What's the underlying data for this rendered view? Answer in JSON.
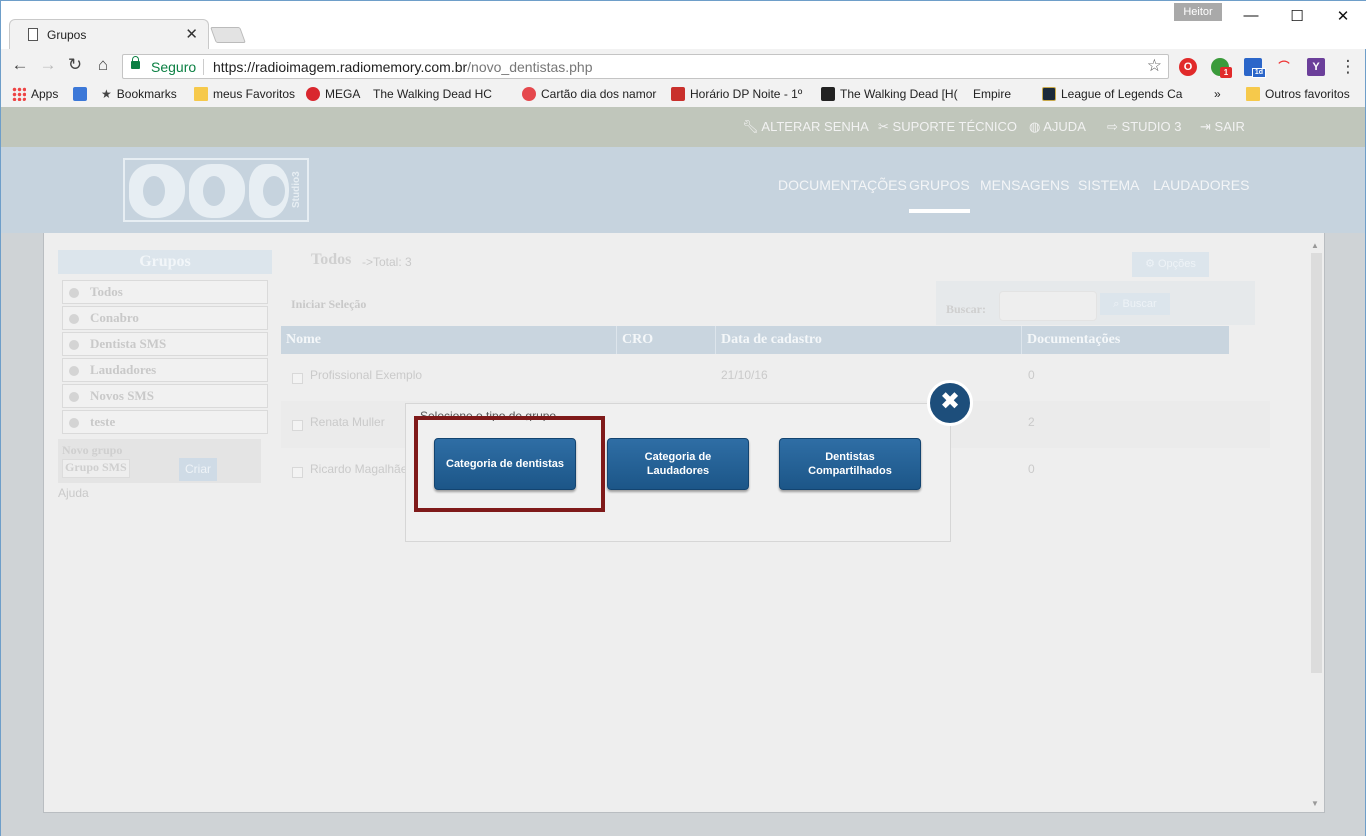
{
  "browser": {
    "tab_title": "Grupos",
    "tab_close": "✕",
    "profile_name": "Heitor",
    "window_controls": {
      "minimize": "—",
      "maximize": "☐",
      "close": "✕"
    },
    "secure_label": "Seguro",
    "url_host": "https://radioimagem.radiomemory.com.br",
    "url_path": "/novo_dentistas.php",
    "bookmarks": [
      {
        "label": "Apps",
        "icon": "apps-icon"
      },
      {
        "label": "",
        "icon": "calendar-icon"
      },
      {
        "label": "Bookmarks",
        "icon": "star-icon"
      },
      {
        "label": "meus Favoritos",
        "icon": "folder-icon"
      },
      {
        "label": "MEGA",
        "icon": "mega-icon"
      },
      {
        "label": "The Walking Dead HC",
        "icon": "page-icon"
      },
      {
        "label": "Cartão dia dos namor",
        "icon": "heart-icon"
      },
      {
        "label": "Horário DP Noite - 1º",
        "icon": "pdf-icon"
      },
      {
        "label": "The Walking Dead [H(",
        "icon": "tv-icon"
      },
      {
        "label": "Empire",
        "icon": "page-icon"
      },
      {
        "label": "League of Legends Ca",
        "icon": "lol-icon"
      }
    ],
    "bookmarks_overflow": "»",
    "other_bookmarks": "Outros favoritos",
    "ext_badge_1": "1",
    "ext_badge_2": "1d"
  },
  "site": {
    "top_links": [
      "ALTERAR SENHA",
      "SUPORTE TÉCNICO",
      "AJUDA",
      "STUDIO 3",
      "SAIR"
    ],
    "logo_text": "Studio3",
    "main_nav": [
      "DOCUMENTAÇÕES",
      "GRUPOS",
      "MENSAGENS",
      "SISTEMA",
      "LAUDADORES"
    ],
    "active_nav": "GRUPOS"
  },
  "sidebar": {
    "title": "Grupos",
    "items": [
      "Todos",
      "Conabro",
      "Dentista SMS",
      "Laudadores",
      "Novos SMS",
      "teste"
    ],
    "new_group_label": "Novo grupo",
    "new_group_value": "Grupo SMS",
    "create_button": "Criar",
    "help": "Ajuda"
  },
  "main": {
    "title": "Todos",
    "total": "->Total: 3",
    "options_button": "⚙ Opções",
    "start_selection": "Iniciar Seleção",
    "search_label": "Buscar:",
    "search_button": "⌕ Buscar",
    "columns": [
      "Nome",
      "CRO",
      "Data de cadastro",
      "Documentações"
    ],
    "rows": [
      {
        "name": "Profissional Exemplo",
        "cro": "",
        "date": "21/10/16",
        "docs": "0"
      },
      {
        "name": "Renata Muller",
        "cro": "",
        "date": "",
        "docs": "2"
      },
      {
        "name": "Ricardo Magalhães",
        "cro": "",
        "date": "",
        "docs": "0"
      }
    ]
  },
  "modal": {
    "header": "Selecione o tipo de grupo",
    "buttons": [
      "Categoria de dentistas",
      "Categoria de Laudadores",
      "Dentistas Compartilhados"
    ],
    "close_icon": "✖"
  }
}
